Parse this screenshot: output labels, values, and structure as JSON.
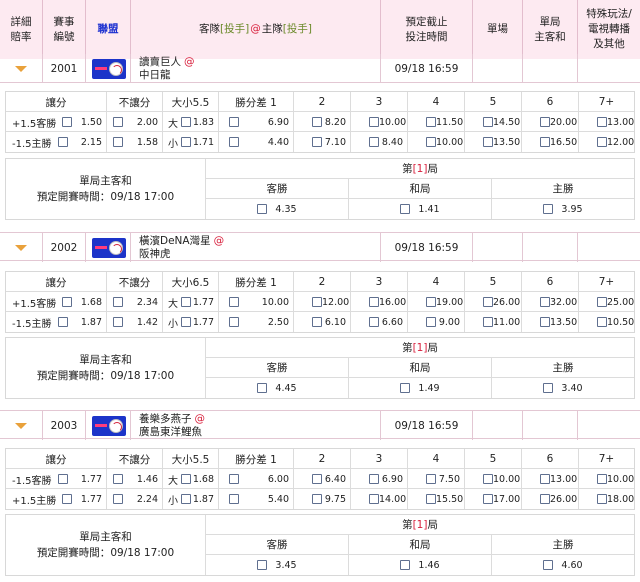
{
  "header": {
    "odds_detail": [
      "詳細",
      "賠率"
    ],
    "event_no": [
      "賽事",
      "編號"
    ],
    "league": "聯盟",
    "teams": {
      "away_pre": "客隊 ",
      "pitcher1": "[投手]",
      "at": "@",
      "home_pre": " 主隊",
      "pitcher2": "[投手]"
    },
    "deadline": [
      "預定截止",
      "投注時間"
    ],
    "single": "單場",
    "single_period": [
      "單局",
      "主客和"
    ],
    "special": [
      "特殊玩法/",
      "電視轉播",
      "及其他"
    ]
  },
  "games": [
    {
      "number": "2001",
      "away": "讀賣巨人",
      "home": "中日龍",
      "time": "09/18 16:59",
      "labels": {
        "spread": "讓分",
        "no_spread": "不讓分",
        "ou": "大小5.5",
        "margin": "勝分差 1",
        "m2": "2",
        "m3": "3",
        "m4": "4",
        "m5": "5",
        "m6": "6",
        "m7": "7+"
      },
      "rows": [
        {
          "side": "+1.5客勝",
          "spread": "1.50",
          "no_spread": "2.00",
          "ou_side": "大",
          "ou": "1.83",
          "m1": "6.90",
          "m2": "8.20",
          "m3": "10.00",
          "m4": "11.50",
          "m5": "14.50",
          "m6": "20.00",
          "m7": "13.00"
        },
        {
          "side": "-1.5主勝",
          "spread": "2.15",
          "no_spread": "1.58",
          "ou_side": "小",
          "ou": "1.71",
          "m1": "4.40",
          "m2": "7.10",
          "m3": "8.40",
          "m4": "10.00",
          "m5": "13.50",
          "m6": "16.50",
          "m7": "12.00"
        }
      ],
      "period": {
        "title": "單局主客和",
        "start_label": "預定開賽時間：",
        "start": "09/18 17:00",
        "period_pre": "第 ",
        "period_num": "[1]",
        "period_post": " 局",
        "away": "客勝",
        "draw": "和局",
        "home": "主勝",
        "away_odds": "4.35",
        "draw_odds": "1.41",
        "home_odds": "3.95"
      }
    },
    {
      "number": "2002",
      "away": "橫濱DeNA灣星",
      "home": "阪神虎",
      "time": "09/18 16:59",
      "labels": {
        "spread": "讓分",
        "no_spread": "不讓分",
        "ou": "大小6.5",
        "margin": "勝分差 1",
        "m2": "2",
        "m3": "3",
        "m4": "4",
        "m5": "5",
        "m6": "6",
        "m7": "7+"
      },
      "rows": [
        {
          "side": "+1.5客勝",
          "spread": "1.68",
          "no_spread": "2.34",
          "ou_side": "大",
          "ou": "1.77",
          "m1": "10.00",
          "m2": "12.00",
          "m3": "16.00",
          "m4": "19.00",
          "m5": "26.00",
          "m6": "32.00",
          "m7": "25.00"
        },
        {
          "side": "-1.5主勝",
          "spread": "1.87",
          "no_spread": "1.42",
          "ou_side": "小",
          "ou": "1.77",
          "m1": "2.50",
          "m2": "6.10",
          "m3": "6.60",
          "m4": "9.00",
          "m5": "11.00",
          "m6": "13.50",
          "m7": "10.50"
        }
      ],
      "period": {
        "title": "單局主客和",
        "start_label": "預定開賽時間：",
        "start": "09/18 17:00",
        "period_pre": "第 ",
        "period_num": "[1]",
        "period_post": " 局",
        "away": "客勝",
        "draw": "和局",
        "home": "主勝",
        "away_odds": "4.45",
        "draw_odds": "1.49",
        "home_odds": "3.40"
      }
    },
    {
      "number": "2003",
      "away": "養樂多燕子",
      "home": "廣島東洋鯉魚",
      "time": "09/18 16:59",
      "labels": {
        "spread": "讓分",
        "no_spread": "不讓分",
        "ou": "大小5.5",
        "margin": "勝分差 1",
        "m2": "2",
        "m3": "3",
        "m4": "4",
        "m5": "5",
        "m6": "6",
        "m7": "7+"
      },
      "rows": [
        {
          "side": "-1.5客勝",
          "spread": "1.77",
          "no_spread": "1.46",
          "ou_side": "大",
          "ou": "1.68",
          "m1": "6.00",
          "m2": "6.40",
          "m3": "6.90",
          "m4": "7.50",
          "m5": "10.00",
          "m6": "13.00",
          "m7": "10.00"
        },
        {
          "side": "+1.5主勝",
          "spread": "1.77",
          "no_spread": "2.24",
          "ou_side": "小",
          "ou": "1.87",
          "m1": "5.40",
          "m2": "9.75",
          "m3": "14.00",
          "m4": "15.50",
          "m5": "17.00",
          "m6": "26.00",
          "m7": "18.00"
        }
      ],
      "period": {
        "title": "單局主客和",
        "start_label": "預定開賽時間：",
        "start": "09/18 17:00",
        "period_pre": "第 ",
        "period_num": "[1]",
        "period_post": " 局",
        "away": "客勝",
        "draw": "和局",
        "home": "主勝",
        "away_odds": "3.45",
        "draw_odds": "1.46",
        "home_odds": "4.60"
      }
    }
  ]
}
